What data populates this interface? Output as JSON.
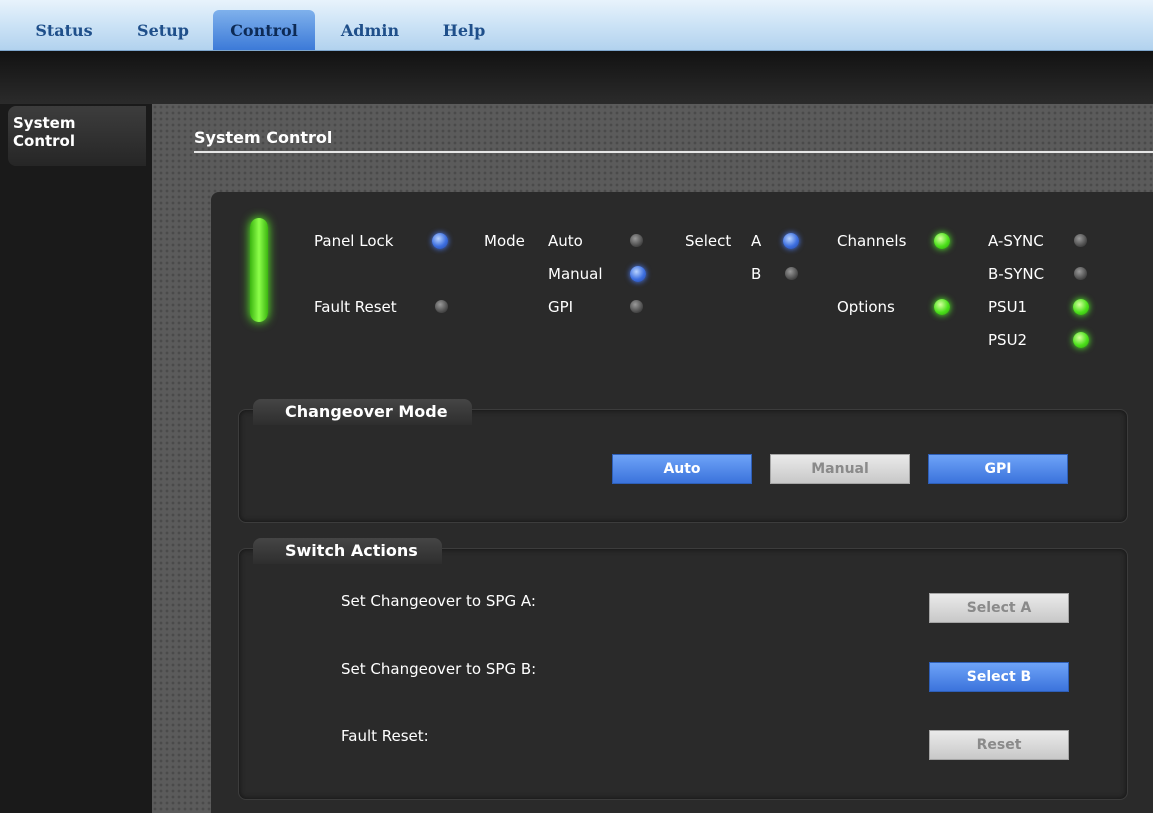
{
  "nav": {
    "tabs": [
      {
        "label": "Status"
      },
      {
        "label": "Setup"
      },
      {
        "label": "Control"
      },
      {
        "label": "Admin"
      },
      {
        "label": "Help"
      }
    ],
    "active": "Control"
  },
  "sidebar": {
    "items": [
      {
        "label_line1": "System",
        "label_line2": "Control"
      }
    ]
  },
  "page": {
    "title": "System Control"
  },
  "status": {
    "panel_lock": "Panel Lock",
    "fault_reset": "Fault Reset",
    "mode": "Mode",
    "mode_auto": "Auto",
    "mode_manual": "Manual",
    "mode_gpi": "GPI",
    "select": "Select",
    "select_a": "A",
    "select_b": "B",
    "channels": "Channels",
    "options": "Options",
    "a_sync": "A-SYNC",
    "b_sync": "B-SYNC",
    "psu1": "PSU1",
    "psu2": "PSU2"
  },
  "changeover": {
    "title": "Changeover Mode",
    "auto": "Auto",
    "manual": "Manual",
    "gpi": "GPI"
  },
  "switch_actions": {
    "title": "Switch Actions",
    "row_a_label": "Set Changeover to SPG A:",
    "row_a_button": "Select A",
    "row_b_label": "Set Changeover to SPG B:",
    "row_b_button": "Select B",
    "row_reset_label": "Fault Reset:",
    "row_reset_button": "Reset"
  },
  "colors": {
    "led_green": "#4be01a",
    "led_blue": "#3d6fe0",
    "led_off": "#6a6a6a",
    "button_active": "#3b73dc"
  }
}
